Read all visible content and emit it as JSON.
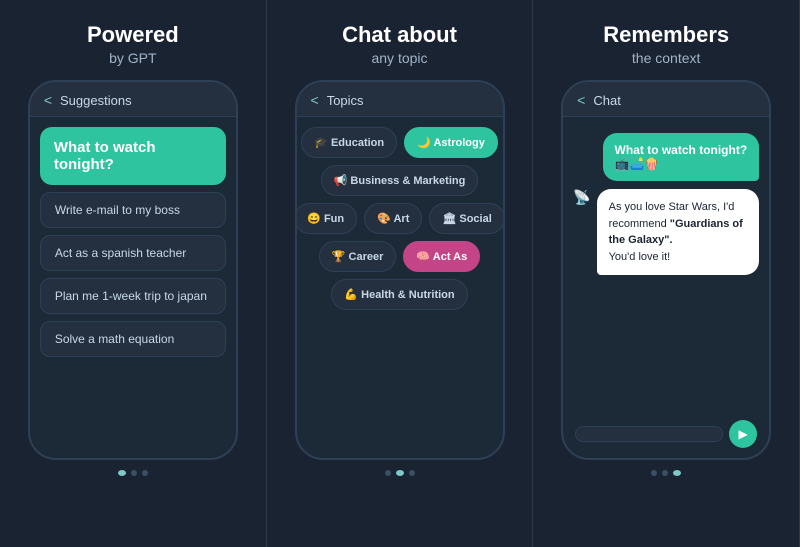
{
  "panels": [
    {
      "title": "Powered",
      "subtitle": "by GPT",
      "header_back": "<",
      "header_title": "Suggestions",
      "highlight": "What to watch tonight?",
      "suggestions": [
        "Write e-mail to my boss",
        "Act as a spanish teacher",
        "Plan me 1-week trip to japan",
        "Solve a math equation"
      ],
      "dots": [
        true,
        false,
        false
      ]
    },
    {
      "title": "Chat about",
      "subtitle": "any topic",
      "header_back": "<",
      "header_title": "Topics",
      "topics_rows": [
        [
          {
            "label": "🎓 Education",
            "style": "normal"
          },
          {
            "label": "🌙 Astrology",
            "style": "active"
          }
        ],
        [
          {
            "label": "📢 Business & Marketing",
            "style": "normal"
          }
        ],
        [
          {
            "label": "😄 Fun",
            "style": "normal"
          },
          {
            "label": "🎨 Art",
            "style": "normal"
          },
          {
            "label": "🏛 Social",
            "style": "normal"
          }
        ],
        [
          {
            "label": "🏆 Career",
            "style": "normal"
          },
          {
            "label": "🧠 Act As",
            "style": "pink"
          }
        ],
        [
          {
            "label": "💪 Health & Nutrition",
            "style": "normal"
          }
        ]
      ],
      "dots": [
        false,
        true,
        false
      ]
    },
    {
      "title": "Remembers",
      "subtitle": "the context",
      "header_back": "<",
      "header_title": "Chat",
      "user_message": "What to watch tonight?\n📺🛋️🍿",
      "assistant_message_pre": "As you love Star Wars, I'd recommend ",
      "assistant_message_bold": "\"Guardians of the Galaxy\".",
      "assistant_message_post": "\nYou'd love it!",
      "input_placeholder": "",
      "send_icon": "▶",
      "dots": [
        false,
        false,
        true
      ]
    }
  ]
}
